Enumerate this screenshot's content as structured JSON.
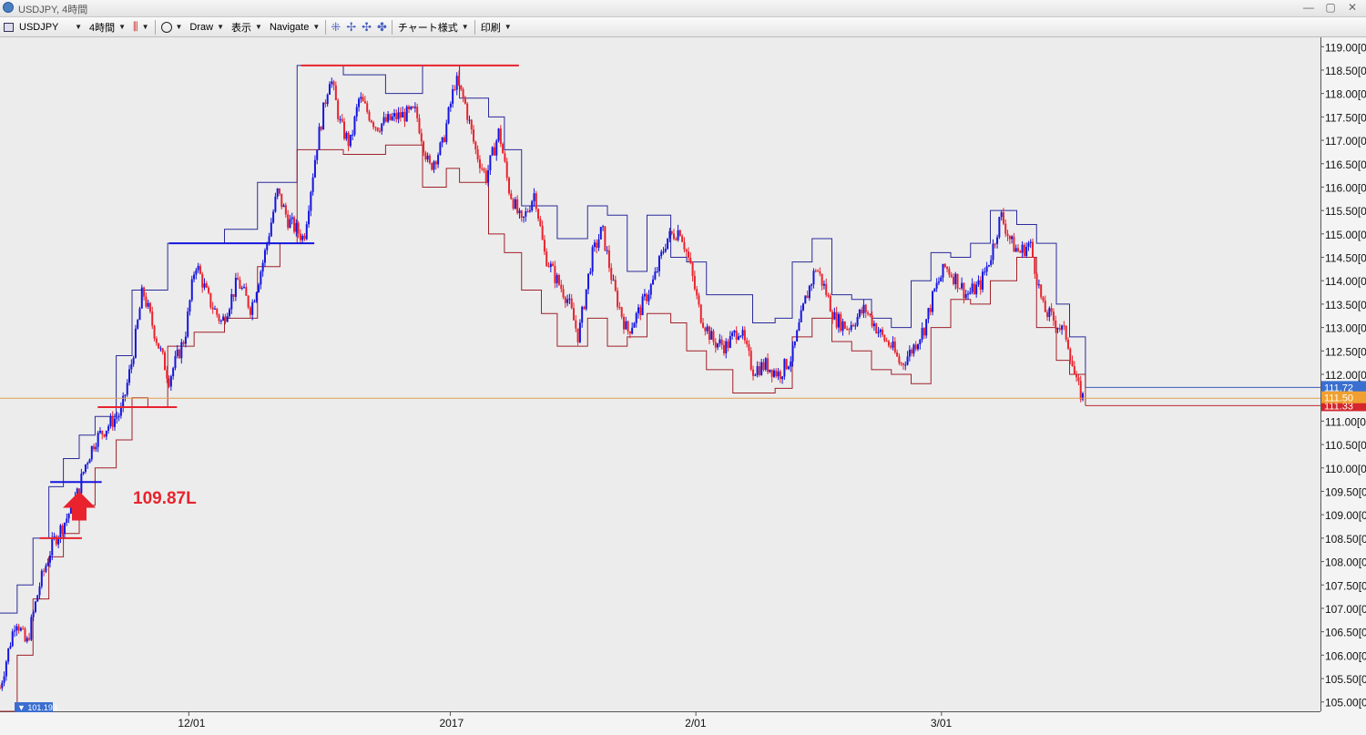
{
  "window": {
    "title": "USDJPY, 4時間",
    "buttons": [
      "—",
      "▢",
      "✕"
    ]
  },
  "toolbar": {
    "symbol": "USDJPY",
    "timeframe": "4時間",
    "draw": "Draw",
    "view": "表示",
    "navigate": "Navigate",
    "chart_style": "チャート様式",
    "print": "印刷",
    "icons": [
      "chart-icon",
      "candlestick-icon",
      "circle-icon",
      "crosshair-icon"
    ]
  },
  "annotation": {
    "text": "109.87L"
  },
  "current_prices": {
    "high": "111.72",
    "close": "111.50",
    "low": "111.33"
  },
  "low_badge": "101.193",
  "colors": {
    "up": "#1515dd",
    "down": "#e8232e",
    "background": "#ececec",
    "price_line": "#e0a050"
  },
  "chart_data": {
    "type": "candlestick",
    "symbol": "USDJPY",
    "timeframe": "4時間",
    "ylim": [
      104.8,
      119.2
    ],
    "yticks": [
      "105.00",
      "105.50",
      "106.00",
      "106.50",
      "107.00",
      "107.50",
      "108.00",
      "108.50",
      "109.00",
      "109.50",
      "110.00",
      "110.50",
      "111.00",
      "111.50",
      "112.00",
      "112.50",
      "113.00",
      "113.50",
      "114.00",
      "114.50",
      "115.00",
      "115.50",
      "116.00",
      "116.50",
      "117.00",
      "117.50",
      "118.00",
      "118.50",
      "119.00"
    ],
    "xticks": [
      {
        "label": "12/01",
        "pos": 0.143
      },
      {
        "label": "2017",
        "pos": 0.341
      },
      {
        "label": "2/01",
        "pos": 0.527
      },
      {
        "label": "3/01",
        "pos": 0.713
      }
    ],
    "path_points": [
      [
        0.0,
        105.3
      ],
      [
        0.012,
        106.8
      ],
      [
        0.02,
        106.2
      ],
      [
        0.03,
        107.5
      ],
      [
        0.04,
        108.4
      ],
      [
        0.05,
        108.9
      ],
      [
        0.058,
        109.4
      ],
      [
        0.065,
        110.1
      ],
      [
        0.072,
        110.6
      ],
      [
        0.085,
        111.0
      ],
      [
        0.092,
        111.2
      ],
      [
        0.1,
        112.3
      ],
      [
        0.108,
        113.8
      ],
      [
        0.118,
        112.8
      ],
      [
        0.128,
        111.9
      ],
      [
        0.14,
        112.8
      ],
      [
        0.148,
        114.4
      ],
      [
        0.158,
        113.6
      ],
      [
        0.168,
        113.1
      ],
      [
        0.18,
        114.0
      ],
      [
        0.19,
        113.4
      ],
      [
        0.2,
        114.5
      ],
      [
        0.21,
        115.9
      ],
      [
        0.218,
        115.3
      ],
      [
        0.23,
        114.9
      ],
      [
        0.24,
        116.9
      ],
      [
        0.25,
        118.4
      ],
      [
        0.258,
        117.3
      ],
      [
        0.265,
        116.9
      ],
      [
        0.272,
        117.9
      ],
      [
        0.285,
        117.3
      ],
      [
        0.3,
        117.5
      ],
      [
        0.315,
        117.6
      ],
      [
        0.325,
        116.4
      ],
      [
        0.335,
        116.9
      ],
      [
        0.345,
        118.3
      ],
      [
        0.352,
        117.8
      ],
      [
        0.36,
        116.8
      ],
      [
        0.368,
        116.2
      ],
      [
        0.378,
        117.2
      ],
      [
        0.385,
        116.0
      ],
      [
        0.395,
        115.2
      ],
      [
        0.405,
        115.9
      ],
      [
        0.412,
        114.6
      ],
      [
        0.42,
        114.1
      ],
      [
        0.43,
        113.6
      ],
      [
        0.438,
        112.8
      ],
      [
        0.448,
        114.5
      ],
      [
        0.456,
        115.1
      ],
      [
        0.465,
        113.8
      ],
      [
        0.475,
        112.9
      ],
      [
        0.485,
        113.4
      ],
      [
        0.495,
        114.0
      ],
      [
        0.505,
        114.9
      ],
      [
        0.515,
        115.1
      ],
      [
        0.522,
        114.4
      ],
      [
        0.53,
        113.3
      ],
      [
        0.54,
        112.7
      ],
      [
        0.55,
        112.6
      ],
      [
        0.56,
        113.0
      ],
      [
        0.57,
        112.1
      ],
      [
        0.58,
        112.2
      ],
      [
        0.59,
        112.0
      ],
      [
        0.6,
        112.4
      ],
      [
        0.61,
        113.6
      ],
      [
        0.618,
        114.3
      ],
      [
        0.625,
        113.8
      ],
      [
        0.632,
        113.2
      ],
      [
        0.642,
        113.0
      ],
      [
        0.655,
        113.4
      ],
      [
        0.668,
        112.8
      ],
      [
        0.675,
        112.6
      ],
      [
        0.682,
        112.2
      ],
      [
        0.69,
        112.5
      ],
      [
        0.7,
        113.0
      ],
      [
        0.708,
        113.8
      ],
      [
        0.716,
        114.3
      ],
      [
        0.725,
        114.0
      ],
      [
        0.732,
        113.7
      ],
      [
        0.742,
        113.9
      ],
      [
        0.75,
        114.5
      ],
      [
        0.758,
        115.4
      ],
      [
        0.766,
        114.8
      ],
      [
        0.772,
        114.6
      ],
      [
        0.78,
        114.8
      ],
      [
        0.79,
        113.4
      ],
      [
        0.8,
        113.1
      ],
      [
        0.808,
        112.8
      ],
      [
        0.815,
        111.8
      ],
      [
        0.82,
        111.5
      ]
    ],
    "channel": {
      "high": [
        [
          0.0,
          106.9
        ],
        [
          0.013,
          107.5
        ],
        [
          0.025,
          108.5
        ],
        [
          0.037,
          109.6
        ],
        [
          0.048,
          110.2
        ],
        [
          0.06,
          110.7
        ],
        [
          0.072,
          111.1
        ],
        [
          0.088,
          112.4
        ],
        [
          0.1,
          113.8
        ],
        [
          0.112,
          113.8
        ],
        [
          0.127,
          114.8
        ],
        [
          0.147,
          114.8
        ],
        [
          0.17,
          115.1
        ],
        [
          0.195,
          116.1
        ],
        [
          0.212,
          116.1
        ],
        [
          0.225,
          118.6
        ],
        [
          0.26,
          118.4
        ],
        [
          0.292,
          118.0
        ],
        [
          0.32,
          118.6
        ],
        [
          0.338,
          118.6
        ],
        [
          0.348,
          117.9
        ],
        [
          0.37,
          117.5
        ],
        [
          0.382,
          116.8
        ],
        [
          0.395,
          115.6
        ],
        [
          0.41,
          115.6
        ],
        [
          0.422,
          114.9
        ],
        [
          0.445,
          115.6
        ],
        [
          0.46,
          115.4
        ],
        [
          0.475,
          114.2
        ],
        [
          0.49,
          115.4
        ],
        [
          0.508,
          114.5
        ],
        [
          0.52,
          114.4
        ],
        [
          0.535,
          113.7
        ],
        [
          0.555,
          113.7
        ],
        [
          0.57,
          113.1
        ],
        [
          0.587,
          113.2
        ],
        [
          0.6,
          114.4
        ],
        [
          0.615,
          114.9
        ],
        [
          0.63,
          113.7
        ],
        [
          0.645,
          113.6
        ],
        [
          0.66,
          113.2
        ],
        [
          0.675,
          113.0
        ],
        [
          0.69,
          114.0
        ],
        [
          0.705,
          114.6
        ],
        [
          0.72,
          114.5
        ],
        [
          0.735,
          114.8
        ],
        [
          0.75,
          115.5
        ],
        [
          0.77,
          115.2
        ],
        [
          0.785,
          114.8
        ],
        [
          0.8,
          113.5
        ],
        [
          0.81,
          112.8
        ],
        [
          0.822,
          111.72
        ]
      ],
      "low": [
        [
          0.0,
          104.8
        ],
        [
          0.013,
          106.0
        ],
        [
          0.025,
          107.2
        ],
        [
          0.037,
          108.1
        ],
        [
          0.048,
          108.6
        ],
        [
          0.06,
          109.2
        ],
        [
          0.072,
          110.0
        ],
        [
          0.088,
          110.6
        ],
        [
          0.1,
          111.5
        ],
        [
          0.112,
          111.3
        ],
        [
          0.127,
          112.6
        ],
        [
          0.147,
          112.9
        ],
        [
          0.17,
          113.2
        ],
        [
          0.195,
          114.3
        ],
        [
          0.212,
          114.8
        ],
        [
          0.225,
          116.8
        ],
        [
          0.26,
          116.7
        ],
        [
          0.292,
          116.9
        ],
        [
          0.32,
          116.0
        ],
        [
          0.338,
          116.4
        ],
        [
          0.348,
          116.1
        ],
        [
          0.37,
          115.0
        ],
        [
          0.382,
          114.6
        ],
        [
          0.395,
          113.8
        ],
        [
          0.41,
          113.3
        ],
        [
          0.422,
          112.6
        ],
        [
          0.445,
          113.2
        ],
        [
          0.46,
          112.6
        ],
        [
          0.475,
          112.8
        ],
        [
          0.49,
          113.3
        ],
        [
          0.508,
          113.1
        ],
        [
          0.52,
          112.5
        ],
        [
          0.535,
          112.1
        ],
        [
          0.555,
          111.6
        ],
        [
          0.57,
          111.6
        ],
        [
          0.587,
          111.7
        ],
        [
          0.6,
          112.8
        ],
        [
          0.615,
          113.2
        ],
        [
          0.63,
          112.7
        ],
        [
          0.645,
          112.5
        ],
        [
          0.66,
          112.1
        ],
        [
          0.675,
          112.0
        ],
        [
          0.69,
          111.8
        ],
        [
          0.705,
          113.0
        ],
        [
          0.72,
          113.6
        ],
        [
          0.735,
          113.5
        ],
        [
          0.75,
          114.0
        ],
        [
          0.77,
          114.5
        ],
        [
          0.785,
          113.0
        ],
        [
          0.8,
          112.3
        ],
        [
          0.81,
          112.0
        ],
        [
          0.822,
          111.33
        ]
      ]
    },
    "horizontal_lines": [
      {
        "price": 118.6,
        "x0": 0.228,
        "x1": 0.393,
        "color": "#e8232e"
      },
      {
        "price": 114.8,
        "x0": 0.128,
        "x1": 0.238,
        "color": "#1515dd"
      },
      {
        "price": 111.3,
        "x0": 0.074,
        "x1": 0.134,
        "color": "#e8232e"
      },
      {
        "price": 109.7,
        "x0": 0.038,
        "x1": 0.077,
        "color": "#1515dd"
      },
      {
        "price": 108.5,
        "x0": 0.03,
        "x1": 0.062,
        "color": "#e8232e"
      }
    ],
    "price_line": 111.5,
    "arrow": {
      "x": 0.06,
      "price": 109.5
    }
  }
}
